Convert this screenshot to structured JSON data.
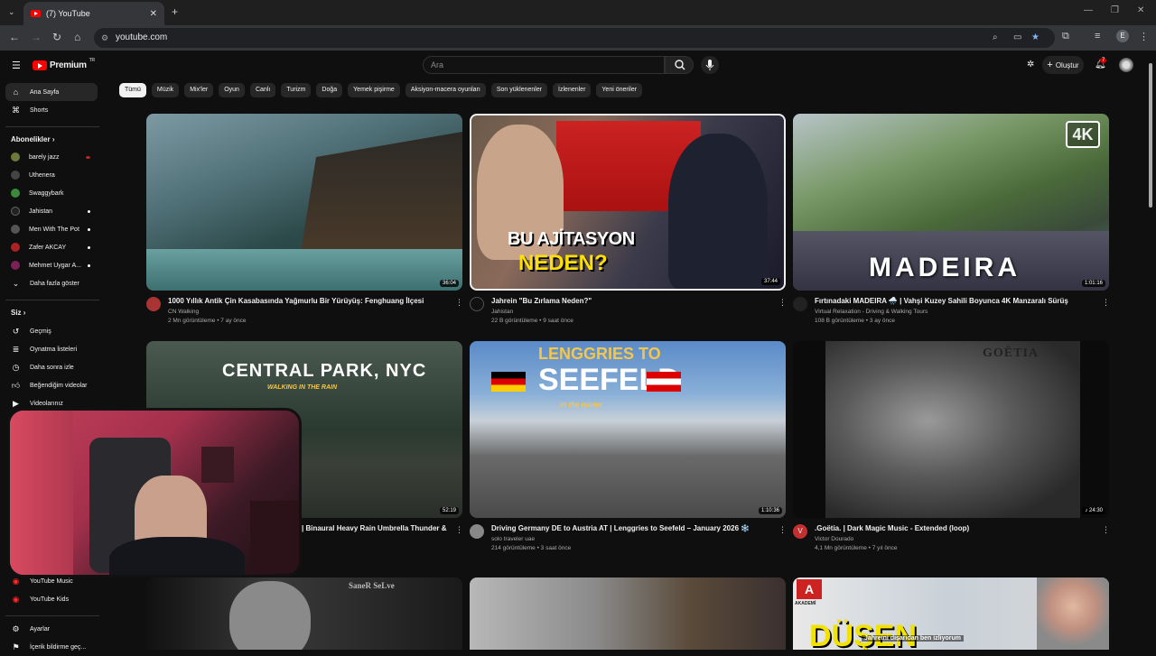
{
  "browser": {
    "tab_title": "(7) YouTube",
    "url": "youtube.com"
  },
  "header": {
    "logo": "Premium",
    "logo_sup": "TR",
    "search_placeholder": "Ara",
    "create_label": "Oluştur",
    "notif_count": "7",
    "avatar_letter": "E"
  },
  "sidebar": {
    "top": [
      {
        "label": "Ana Sayfa",
        "icon": "home-icon"
      },
      {
        "label": "Shorts",
        "icon": "shorts-icon"
      }
    ],
    "subs_title": "Abonelikler",
    "subs": [
      {
        "label": "barely jazz",
        "color": "#6b7a3a"
      },
      {
        "label": "Uthenera",
        "color": "#444"
      },
      {
        "label": "Swaggybark",
        "color": "#3a8a3a"
      },
      {
        "label": "Jahistan",
        "color": "#222"
      },
      {
        "label": "Men With The Pot",
        "color": "#555"
      },
      {
        "label": "Zafer AKCAY",
        "color": "#aa2222"
      },
      {
        "label": "Mehmet Uygar A...",
        "color": "#7a2255"
      }
    ],
    "show_more": "Daha fazla göster",
    "you_title": "Siz",
    "you_items": [
      {
        "label": "Geçmiş"
      },
      {
        "label": "Oynatma listeleri"
      },
      {
        "label": "Daha sonra izle"
      },
      {
        "label": "Beğendiğim videolar"
      },
      {
        "label": "Videolarınız"
      }
    ],
    "bottom_items": [
      {
        "label": "YouTube Music"
      },
      {
        "label": "YouTube Kids"
      },
      {
        "label": "Ayarlar"
      },
      {
        "label": "İçerik bildirme geç..."
      }
    ]
  },
  "chips": [
    "Tümü",
    "Müzik",
    "Mix'ler",
    "Oyun",
    "Canlı",
    "Turizm",
    "Doğa",
    "Yemek pişirme",
    "Aksiyon-macera oyunları",
    "Son yüklenenler",
    "İzlenenler",
    "Yeni öneriler"
  ],
  "videos": [
    {
      "title": "1000 Yıllık Antik Çin Kasabasında Yağmurlu Bir Yürüyüş: Fenghuang İlçesi",
      "channel": "CN Walking",
      "meta": "2 Mn görüntüleme • 7 ay önce",
      "duration": "36:04"
    },
    {
      "title": "Jahrein \"Bu Zırlama Neden?\"",
      "channel": "Jahistan",
      "meta": "22 B görüntüleme • 9 saat önce",
      "duration": "37:44",
      "overlay1": "BU AJİTASYON",
      "overlay2": "NEDEN?"
    },
    {
      "title": "Fırtınadaki MADEIRA 🌧️ | Vahşi Kuzey Sahili Boyunca 4K Manzaralı Sürüş",
      "channel": "Virtual Relaxation - Driving & Walking Tours",
      "meta": "108 B görüntüleme • 3 ay önce",
      "duration": "1:01:16",
      "overlay1": "MADEIRA",
      "badge": "4K"
    },
    {
      "title": "| Binaural Heavy Rain Umbrella Thunder &",
      "channel": "",
      "meta": "",
      "duration": "52:19",
      "overlay1": "CENTRAL PARK, NYC",
      "overlay2": "WALKING IN THE RAIN"
    },
    {
      "title": "Driving Germany DE to Austria AT | Lenggries to Seefeld – January 2026 ❄️",
      "channel": "solo traveler uae",
      "meta": "214 görüntüleme • 3 saat önce",
      "duration": "1:10:36",
      "overlay1": "LENGGRIES TO",
      "overlay2": "SEEFELD",
      "overlay3": "in the winter"
    },
    {
      "title": ".Goëtia. | Dark Magic Music - Extended (loop)",
      "channel": "Victor Dourado",
      "meta": "4,1 Mn görüntüleme • 7 yıl önce",
      "duration": "♪ 24:30",
      "overlay1": "GOËTIA"
    },
    {
      "overlay1": "SaneR SeLve"
    },
    {},
    {
      "overlay1": "DÜŞEN",
      "overlay2": "AKADEMİ",
      "subtitle": "Jahreini dışarıdan ben izliyorum"
    }
  ],
  "colors": {
    "bg": "#0f0f0f",
    "accent": "#ff0000",
    "chip": "#272727"
  }
}
